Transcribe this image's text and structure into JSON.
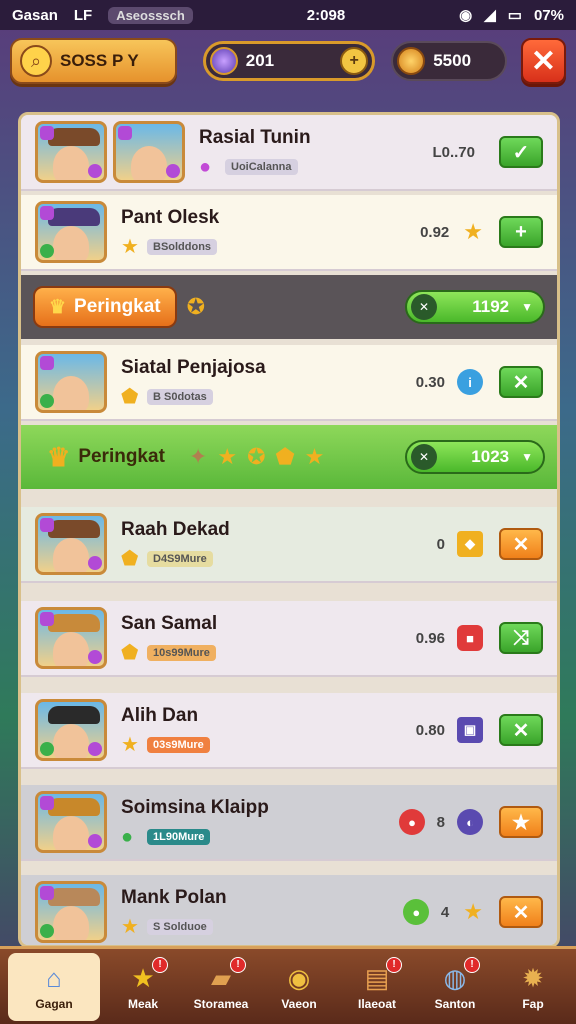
{
  "status_bar": {
    "carrier": "Gasan",
    "carrier_extra": "LF",
    "app_chip": "Aseosssch",
    "time": "2:098",
    "battery": "07%"
  },
  "header": {
    "left_label": "SOSS P Y",
    "gems": "201",
    "coins": "5500"
  },
  "rows": [
    {
      "name": "Rasial Tunin",
      "tag": "UoiCalanna",
      "score": "L0..70",
      "action": "check",
      "action_color": "green"
    },
    {
      "name": "Pant Olesk",
      "tag": "BSolddons",
      "score": "0.92",
      "action": "plus",
      "action_color": "green"
    },
    {
      "name": "Siatal Penjajosa",
      "tag": "B S0dotas",
      "score": "0.30",
      "action": "close",
      "action_color": "green"
    },
    {
      "name": "Raah Dekad",
      "tag": "D4S9Mure",
      "score": "0",
      "action": "close",
      "action_color": "orange"
    },
    {
      "name": "San Samal",
      "tag": "10s99Mure",
      "score": "0.96",
      "action": "shuffle",
      "action_color": "green"
    },
    {
      "name": "Alih Dan",
      "tag": "03s9Mure",
      "score": "0.80",
      "action": "close",
      "action_color": "green"
    },
    {
      "name": "Soimsina Klaipp",
      "tag": "1L90Mure",
      "score": "8",
      "action": "star",
      "action_color": "orange"
    },
    {
      "name": "Mank Polan",
      "tag": "S Solduoe",
      "score": "4",
      "action": "close",
      "action_color": "orange"
    }
  ],
  "rank_bars": [
    {
      "label": "Peringkat",
      "value": "1192"
    },
    {
      "label": "Peringkat",
      "value": "1023"
    }
  ],
  "nav": [
    {
      "label": "Gagan",
      "icon": "home-icon"
    },
    {
      "label": "Meak",
      "icon": "star-icon"
    },
    {
      "label": "Storamea",
      "icon": "ticket-icon"
    },
    {
      "label": "Vaeon",
      "icon": "cat-icon"
    },
    {
      "label": "Ilaeoat",
      "icon": "scroll-icon"
    },
    {
      "label": "Santon",
      "icon": "globe-icon"
    },
    {
      "label": "Fap",
      "icon": "gear-icon"
    }
  ]
}
